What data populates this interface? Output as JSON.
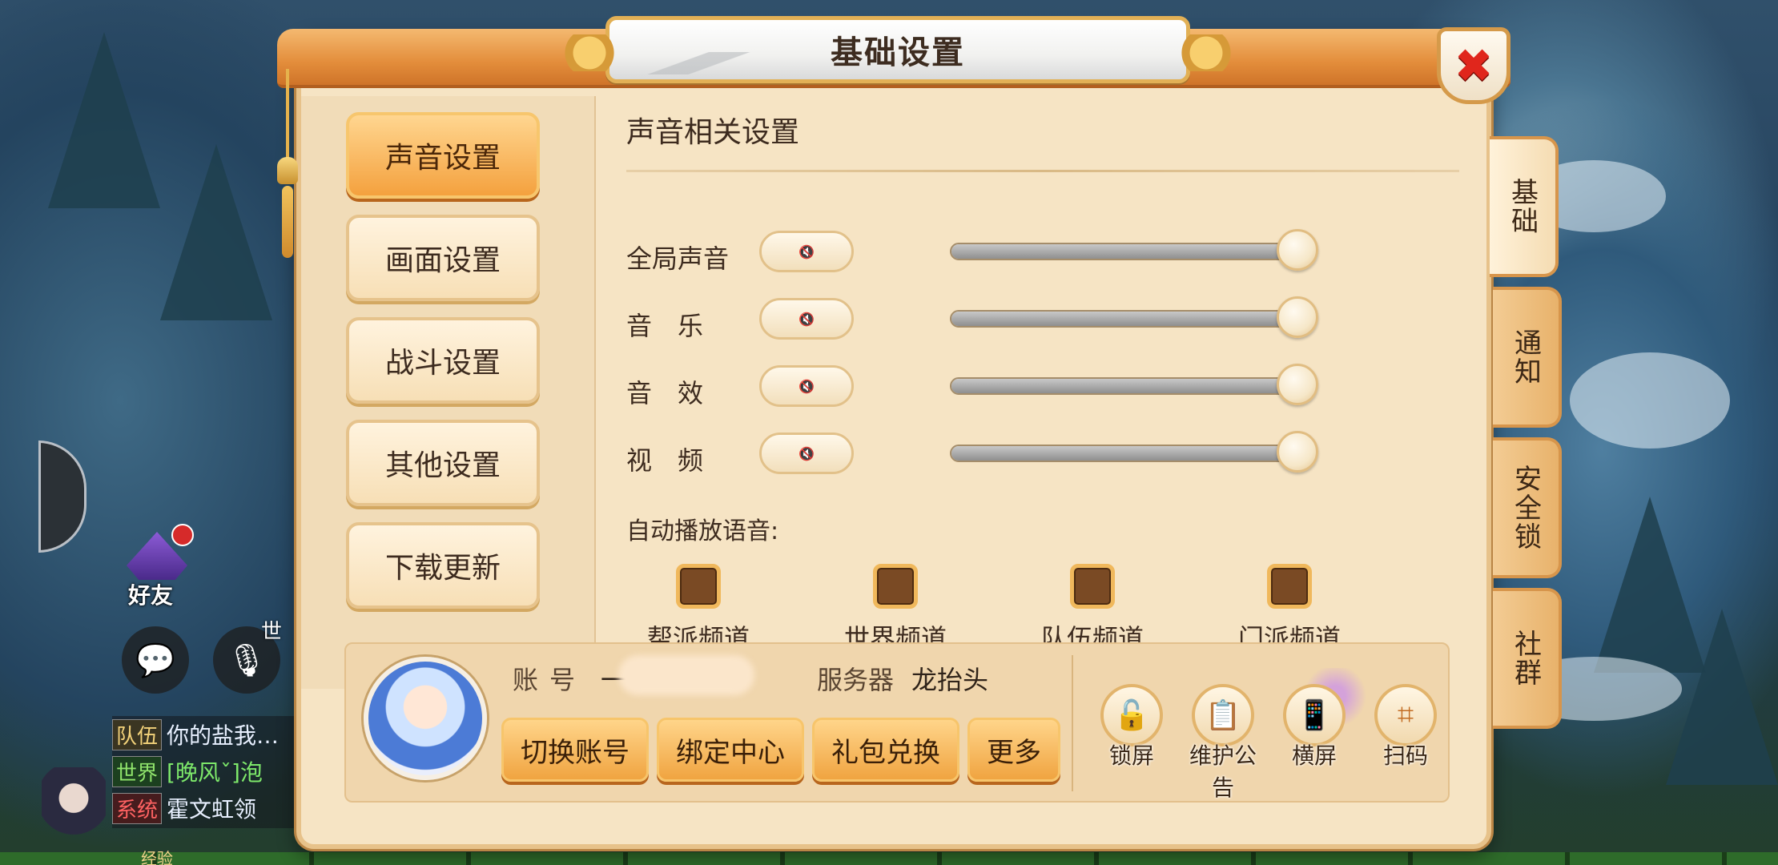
{
  "dialog": {
    "title": "基础设置",
    "close_symbol": "✖"
  },
  "left_menu": [
    {
      "label": "声音设置",
      "active": true
    },
    {
      "label": "画面设置",
      "active": false
    },
    {
      "label": "战斗设置",
      "active": false
    },
    {
      "label": "其他设置",
      "active": false
    },
    {
      "label": "下载更新",
      "active": false
    }
  ],
  "side_tabs": [
    {
      "label": "基础",
      "active": true
    },
    {
      "label": "通知",
      "active": false
    },
    {
      "label": "安全锁",
      "active": false
    },
    {
      "label": "社群",
      "active": false
    }
  ],
  "sound": {
    "section_title": "声音相关设置",
    "mute_icon": "speaker-muted-icon",
    "rows": [
      {
        "label": "全局声音",
        "level": 1.0
      },
      {
        "label": "音　乐",
        "level": 1.0
      },
      {
        "label": "音　效",
        "level": 1.0
      },
      {
        "label": "视　频",
        "level": 1.0
      }
    ],
    "auto_play_title": "自动播放语音:",
    "channels": [
      {
        "label": "帮派频道",
        "checked": false
      },
      {
        "label": "世界频道",
        "checked": false
      },
      {
        "label": "队伍频道",
        "checked": false
      },
      {
        "label": "门派频道",
        "checked": false
      }
    ]
  },
  "account": {
    "account_label": "账号",
    "account_value": "一",
    "server_label": "服务器",
    "server_value": "龙抬头",
    "buttons": [
      "切换账号",
      "绑定中心",
      "礼包兑换",
      "更多"
    ],
    "tools": [
      {
        "label": "锁屏",
        "icon": "lock-icon",
        "glyph": "🔓"
      },
      {
        "label": "维护公告",
        "icon": "clipboard-icon",
        "glyph": "📋"
      },
      {
        "label": "横屏",
        "icon": "rotate-screen-icon",
        "glyph": "📱"
      },
      {
        "label": "扫码",
        "icon": "scan-icon",
        "glyph": "⌗"
      }
    ]
  },
  "hud": {
    "friend_label": "好友",
    "world_tag": "世",
    "chat": [
      {
        "tag": "队伍",
        "msg": "你的盐我…"
      },
      {
        "tag": "世界",
        "msg": "[晚风ˇ]泡"
      },
      {
        "tag": "系统",
        "msg": "霍文虹领"
      }
    ],
    "exp_label": "经验"
  },
  "colors": {
    "accent_orange": "#f0a441",
    "panel_bg": "#f6e4c4",
    "close_red": "#e0261c"
  }
}
